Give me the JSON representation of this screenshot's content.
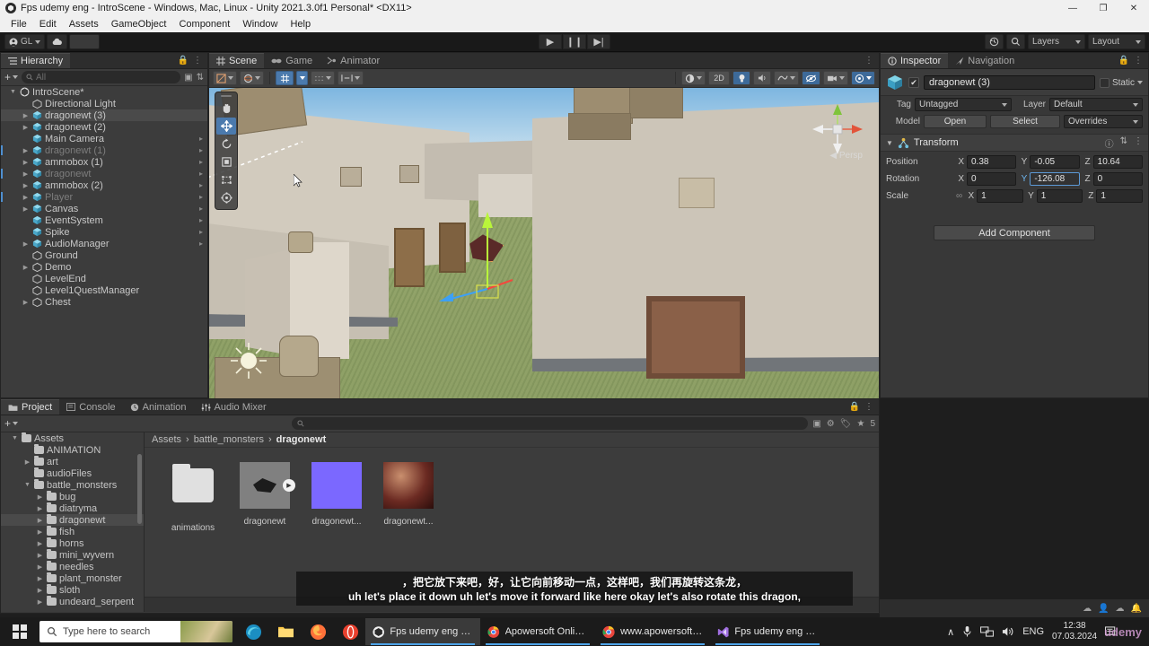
{
  "window": {
    "title": "Fps udemy eng - IntroScene - Windows, Mac, Linux - Unity 2021.3.0f1 Personal* <DX11>",
    "minimize": "—",
    "maximize": "❐",
    "close": "✕"
  },
  "menu": {
    "items": [
      "File",
      "Edit",
      "Assets",
      "GameObject",
      "Component",
      "Window",
      "Help"
    ]
  },
  "toolbar": {
    "account_label": "GL",
    "cloud_label": "cloud-icon",
    "play": "▶",
    "pause": "❙❙",
    "step": "▶|",
    "history_icon": "history-icon",
    "search_icon": "search-icon",
    "layers_label": "Layers",
    "layout_label": "Layout"
  },
  "hierarchy": {
    "tab": "Hierarchy",
    "add_label": "+",
    "search_placeholder": "All",
    "items": [
      {
        "label": "IntroScene*",
        "depth": 0,
        "type": "scene",
        "twisty": "▼",
        "selected": false,
        "dim": false,
        "arrow": false
      },
      {
        "label": "Directional Light",
        "depth": 1,
        "type": "light",
        "twisty": "",
        "selected": false,
        "dim": false,
        "arrow": false
      },
      {
        "label": "dragonewt (3)",
        "depth": 1,
        "type": "prefab",
        "twisty": "▶",
        "selected": true,
        "dim": false,
        "arrow": false
      },
      {
        "label": "dragonewt (2)",
        "depth": 1,
        "type": "prefab",
        "twisty": "▶",
        "selected": false,
        "dim": false,
        "arrow": false
      },
      {
        "label": "Main Camera",
        "depth": 1,
        "type": "prefab",
        "twisty": "",
        "selected": false,
        "dim": false,
        "arrow": true
      },
      {
        "label": "dragonewt (1)",
        "depth": 1,
        "type": "prefab",
        "twisty": "▶",
        "selected": false,
        "dim": true,
        "arrow": true
      },
      {
        "label": "ammobox (1)",
        "depth": 1,
        "type": "prefab",
        "twisty": "▶",
        "selected": false,
        "dim": false,
        "arrow": true
      },
      {
        "label": "dragonewt",
        "depth": 1,
        "type": "prefab",
        "twisty": "▶",
        "selected": false,
        "dim": true,
        "arrow": true
      },
      {
        "label": "ammobox (2)",
        "depth": 1,
        "type": "prefab",
        "twisty": "▶",
        "selected": false,
        "dim": false,
        "arrow": true
      },
      {
        "label": "Player",
        "depth": 1,
        "type": "prefab",
        "twisty": "▶",
        "selected": false,
        "dim": true,
        "arrow": true
      },
      {
        "label": "Canvas",
        "depth": 1,
        "type": "prefab",
        "twisty": "▶",
        "selected": false,
        "dim": false,
        "arrow": true
      },
      {
        "label": "EventSystem",
        "depth": 1,
        "type": "prefab",
        "twisty": "",
        "selected": false,
        "dim": false,
        "arrow": true
      },
      {
        "label": "Spike",
        "depth": 1,
        "type": "prefab",
        "twisty": "",
        "selected": false,
        "dim": false,
        "arrow": true
      },
      {
        "label": "AudioManager",
        "depth": 1,
        "type": "prefab",
        "twisty": "▶",
        "selected": false,
        "dim": false,
        "arrow": true
      },
      {
        "label": "Ground",
        "depth": 1,
        "type": "object",
        "twisty": "",
        "selected": false,
        "dim": false,
        "arrow": false
      },
      {
        "label": "Demo",
        "depth": 1,
        "type": "object",
        "twisty": "▶",
        "selected": false,
        "dim": false,
        "arrow": false
      },
      {
        "label": "LevelEnd",
        "depth": 1,
        "type": "object",
        "twisty": "",
        "selected": false,
        "dim": false,
        "arrow": false
      },
      {
        "label": "Level1QuestManager",
        "depth": 1,
        "type": "object",
        "twisty": "",
        "selected": false,
        "dim": false,
        "arrow": false
      },
      {
        "label": "Chest",
        "depth": 1,
        "type": "object",
        "twisty": "▶",
        "selected": false,
        "dim": false,
        "arrow": false
      }
    ]
  },
  "sceneview": {
    "tabs": [
      {
        "label": "Scene",
        "icon": "grid-icon",
        "active": true
      },
      {
        "label": "Game",
        "icon": "gamepad-icon",
        "active": false
      },
      {
        "label": "Animator",
        "icon": "animator-icon",
        "active": false
      }
    ],
    "toolbar": {
      "shading_label": "shading-mode-icon",
      "draw_mode_label": "draw-mode-icon",
      "two_d_label": "2D",
      "light_label": "lighting-toggle-icon",
      "audio_label": "audio-toggle-icon",
      "fx_label": "effects-icon",
      "hidden_label": "visibility-icon",
      "camera_label": "scene-camera-icon",
      "gizmos_label": "gizmos-icon"
    },
    "tools": [
      {
        "name": "hand-tool",
        "glyph": "✋",
        "active": false
      },
      {
        "name": "move-tool",
        "glyph": "✥",
        "active": true
      },
      {
        "name": "rotate-tool",
        "glyph": "↻",
        "active": false
      },
      {
        "name": "scale-tool",
        "glyph": "⧉",
        "active": false
      },
      {
        "name": "rect-tool",
        "glyph": "⬚",
        "active": false
      },
      {
        "name": "transform-tool",
        "glyph": "❂",
        "active": false
      }
    ],
    "persp_label": "Persp",
    "gizmo_axes": {
      "x": "X",
      "y": "Y",
      "z": "Z"
    }
  },
  "inspector": {
    "tabs": [
      {
        "label": "Inspector",
        "active": true
      },
      {
        "label": "Navigation",
        "active": false
      }
    ],
    "object_name": "dragonewt (3)",
    "enabled_check": "✔",
    "static_label": "Static",
    "tag_label": "Tag",
    "tag_value": "Untagged",
    "layer_label": "Layer",
    "layer_value": "Default",
    "model_label": "Model",
    "open_label": "Open",
    "select_label": "Select",
    "overrides_label": "Overrides",
    "transform": {
      "title": "Transform",
      "rows": [
        {
          "label": "Position",
          "x": "0.38",
          "y": "-0.05",
          "z": "10.64",
          "focus": ""
        },
        {
          "label": "Rotation",
          "x": "0",
          "y": "-126.08",
          "z": "0",
          "focus": "y"
        },
        {
          "label": "Scale",
          "x": "1",
          "y": "1",
          "z": "1",
          "focus": ""
        }
      ],
      "axis_x": "X",
      "axis_y": "Y",
      "axis_z": "Z",
      "link_icon": "constrain-proportions-icon"
    },
    "add_component_label": "Add Component"
  },
  "project": {
    "tabs": [
      {
        "label": "Project",
        "icon": "folder-icon",
        "active": true
      },
      {
        "label": "Console",
        "icon": "console-icon",
        "active": false
      },
      {
        "label": "Animation",
        "icon": "clock-icon",
        "active": false
      },
      {
        "label": "Audio Mixer",
        "icon": "mixer-icon",
        "active": false
      }
    ],
    "add_label": "+",
    "search_placeholder": "",
    "badge_count": "5",
    "tree": [
      {
        "label": "Assets",
        "depth": 0,
        "twisty": "▼",
        "selected": false
      },
      {
        "label": "ANIMATION",
        "depth": 1,
        "twisty": "",
        "selected": false
      },
      {
        "label": "art",
        "depth": 1,
        "twisty": "▶",
        "selected": false
      },
      {
        "label": "audioFiles",
        "depth": 1,
        "twisty": "",
        "selected": false
      },
      {
        "label": "battle_monsters",
        "depth": 1,
        "twisty": "▼",
        "selected": false
      },
      {
        "label": "bug",
        "depth": 2,
        "twisty": "▶",
        "selected": false
      },
      {
        "label": "diatryma",
        "depth": 2,
        "twisty": "▶",
        "selected": false
      },
      {
        "label": "dragonewt",
        "depth": 2,
        "twisty": "▶",
        "selected": true
      },
      {
        "label": "fish",
        "depth": 2,
        "twisty": "▶",
        "selected": false
      },
      {
        "label": "horns",
        "depth": 2,
        "twisty": "▶",
        "selected": false
      },
      {
        "label": "mini_wyvern",
        "depth": 2,
        "twisty": "▶",
        "selected": false
      },
      {
        "label": "needles",
        "depth": 2,
        "twisty": "▶",
        "selected": false
      },
      {
        "label": "plant_monster",
        "depth": 2,
        "twisty": "▶",
        "selected": false
      },
      {
        "label": "sloth",
        "depth": 2,
        "twisty": "▶",
        "selected": false
      },
      {
        "label": "undeard_serpent",
        "depth": 2,
        "twisty": "▶",
        "selected": false
      }
    ],
    "breadcrumb": [
      "Assets",
      "battle_monsters",
      "dragonewt"
    ],
    "assets": [
      {
        "label": "animations",
        "kind": "folder"
      },
      {
        "label": "dragonewt",
        "kind": "model"
      },
      {
        "label": "dragonewt...",
        "kind": "material"
      },
      {
        "label": "dragonewt...",
        "kind": "texture"
      }
    ]
  },
  "subtitle": {
    "chinese": "，把它放下来吧，好，让它向前移动一点，这样吧，我们再旋转这条龙，",
    "english": "uh let's place it down uh let's move it forward like here okay let's also rotate this dragon,"
  },
  "taskbar": {
    "search_placeholder": "Type here to search",
    "pinned": [
      "edge-icon",
      "file-explorer-icon",
      "firefox-icon",
      "opera-icon"
    ],
    "apps": [
      {
        "label": "Fps udemy eng - In...",
        "icon": "unity-icon",
        "active": true
      },
      {
        "label": "Apowersoft Online ...",
        "icon": "chrome-icon",
        "active": false
      },
      {
        "label": "www.apowersoft.c...",
        "icon": "chrome-icon",
        "active": false
      },
      {
        "label": "Fps udemy eng - M...",
        "icon": "vs-icon",
        "active": false
      }
    ],
    "tray": {
      "chevron": "∧",
      "mic": "mic-icon",
      "network": "network-icon",
      "volume": "volume-icon",
      "language": "ENG",
      "time": "12:38",
      "date": "07.03.2024",
      "notifications": "notification-icon",
      "watermark": "udemy"
    }
  }
}
